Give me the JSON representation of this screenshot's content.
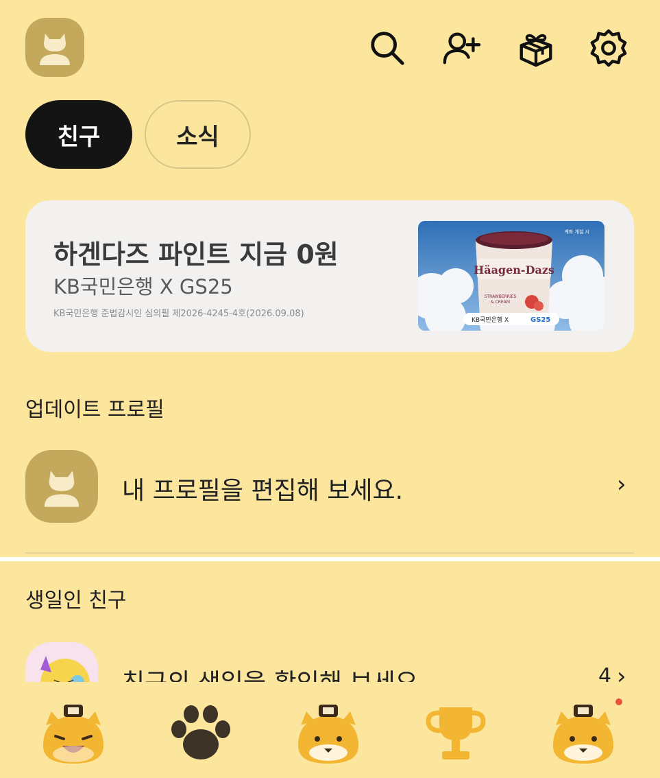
{
  "header": {
    "icons": [
      "search-icon",
      "add-friend-icon",
      "gift-icon",
      "settings-icon"
    ]
  },
  "tabs": [
    {
      "label": "친구",
      "active": true
    },
    {
      "label": "소식",
      "active": false
    }
  ],
  "ad": {
    "title": "하겐다즈 파인트 지금 0원",
    "subtitle": "KB국민은행 X GS25",
    "fineprint": "KB국민은행 준법감시인 심의필 제2026-4245-4호(2026.09.08)",
    "image": {
      "badge": "계좌 개설 시",
      "brand": "Häagen-Dazs",
      "flavor_line1": "STRAWBERRIES",
      "flavor_line2": "& CREAM",
      "partner": "KB국민은행 X",
      "partner2": "GS25"
    }
  },
  "update_profile": {
    "heading": "업데이트 프로필",
    "row_text": "내 프로필을 편집해 보세요.",
    "chevron": "›"
  },
  "birthday": {
    "heading": "생일인 친구",
    "row_text": "친구의 생일을 확인해 보세요.",
    "count": "4",
    "chevron": "›"
  },
  "bottom_nav": [
    {
      "name": "friends",
      "icon": "tiger-character-icon"
    },
    {
      "name": "chats",
      "icon": "paw-icon"
    },
    {
      "name": "openchat",
      "icon": "tiger-character-icon"
    },
    {
      "name": "shopping",
      "icon": "trophy-icon"
    },
    {
      "name": "more",
      "icon": "tiger-character-icon",
      "has_badge": true
    }
  ],
  "colors": {
    "background": "#fce69e",
    "avatar": "#c4a85c",
    "active_tab": "#141414",
    "badge_dot": "#e8533c"
  }
}
